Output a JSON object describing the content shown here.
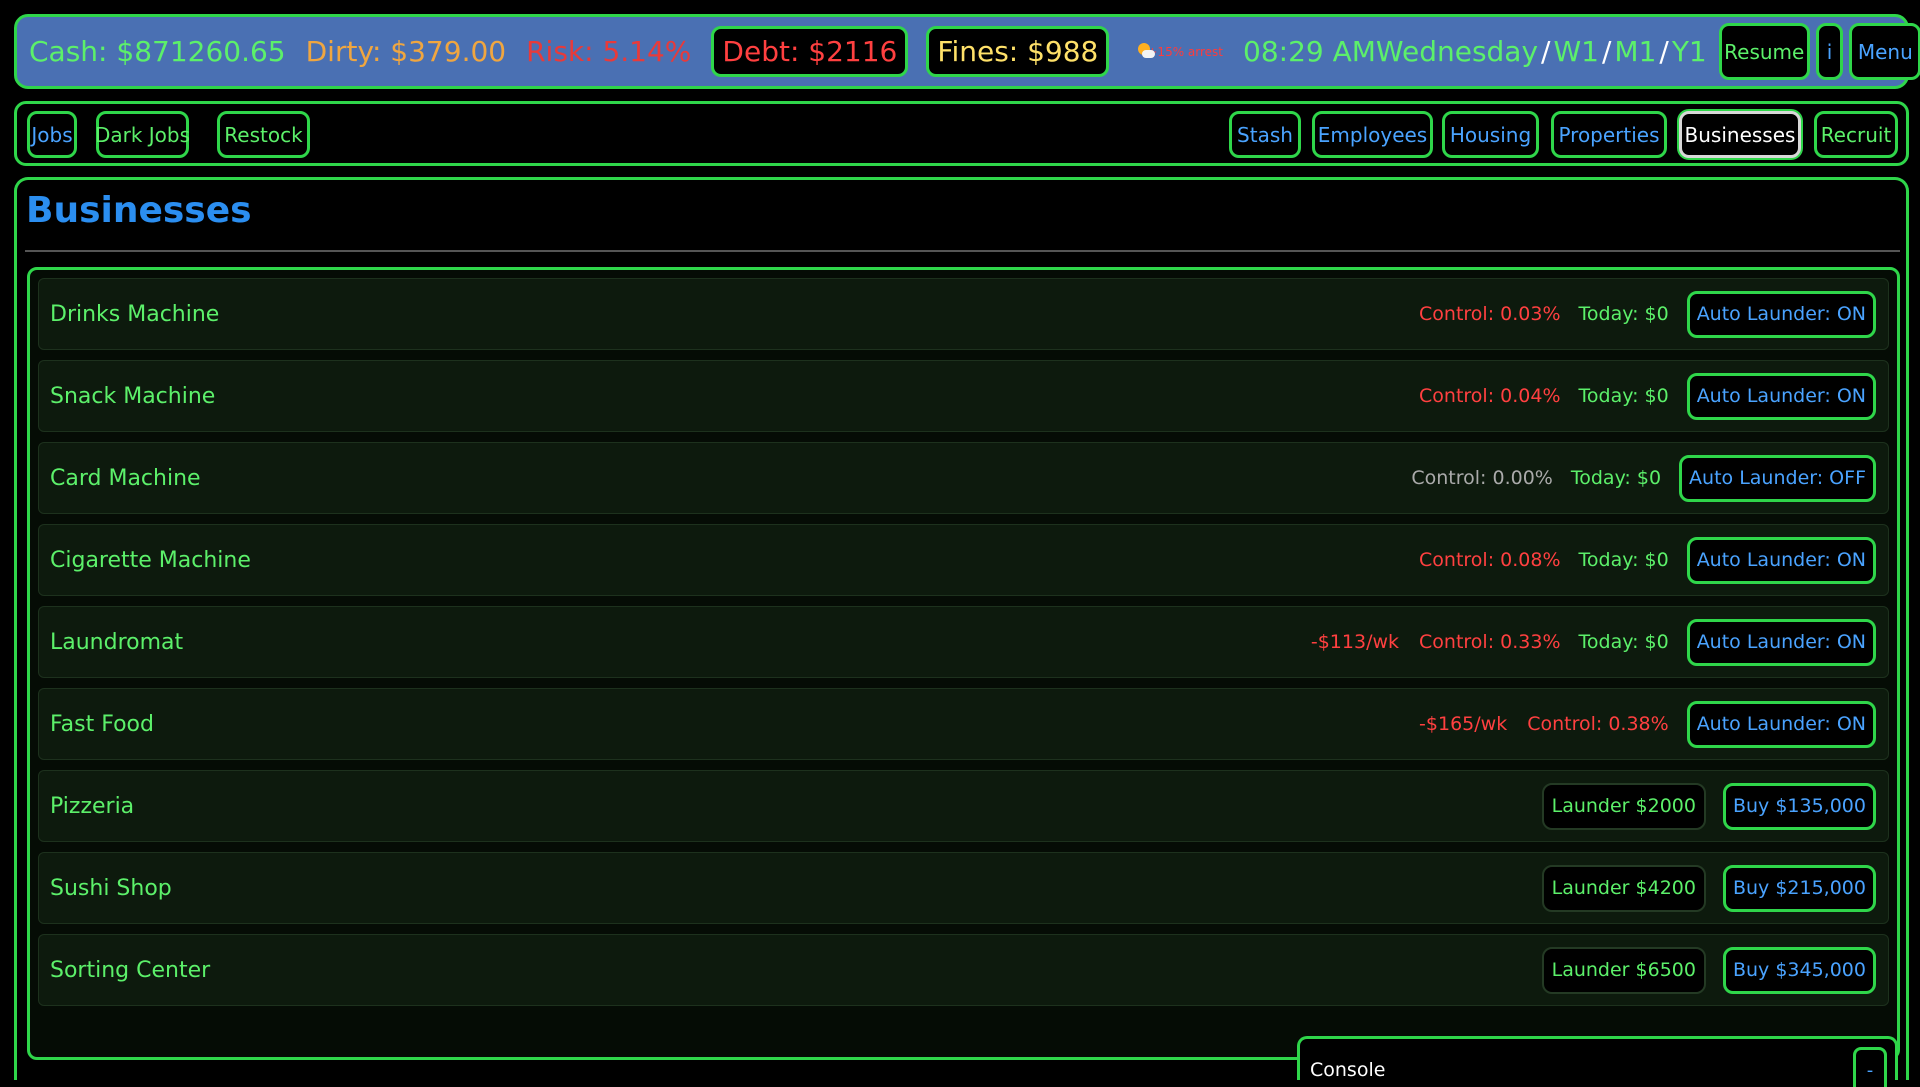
{
  "status": {
    "cash": "Cash: $871260.65",
    "dirty": "Dirty: $379.00",
    "risk": "Risk: 5.14%",
    "debt": "Debt: $2116",
    "fines": "Fines: $988",
    "weather_icon": "sun-cloud-icon",
    "weather_note": "+15% arrest",
    "time": "08:29 AM",
    "date_day": "Wednesday",
    "date_week": "W1",
    "date_month": "M1",
    "date_year": "Y1",
    "date_separator": "/",
    "resume_label": "Resume",
    "info_label": "i",
    "menu_label": "Menu"
  },
  "nav": {
    "jobs": "Jobs",
    "dark_jobs": "Dark Jobs",
    "restock": "Restock",
    "stash": "Stash",
    "employees": "Employees",
    "housing": "Housing",
    "properties": "Properties",
    "businesses": "Businesses",
    "recruit": "Recruit",
    "active_tab": "Businesses"
  },
  "page": {
    "title": "Businesses"
  },
  "businesses": [
    {
      "name": "Drinks Machine",
      "upkeep": "",
      "control": "Control: 0.03%",
      "today": "Today: $0",
      "action": "Auto Launder: ON"
    },
    {
      "name": "Snack Machine",
      "upkeep": "",
      "control": "Control: 0.04%",
      "today": "Today: $0",
      "action": "Auto Launder: ON"
    },
    {
      "name": "Card Machine",
      "upkeep": "",
      "control": "Control: 0.00%",
      "today": "Today: $0",
      "action": "Auto Launder: OFF"
    },
    {
      "name": "Cigarette Machine",
      "upkeep": "",
      "control": "Control: 0.08%",
      "today": "Today: $0",
      "action": "Auto Launder: ON"
    },
    {
      "name": "Laundromat",
      "upkeep": "-$113/wk",
      "control": "Control: 0.33%",
      "today": "Today: $0",
      "action": "Auto Launder: ON"
    },
    {
      "name": "Fast Food",
      "upkeep": "-$165/wk",
      "control": "Control: 0.38%",
      "today": "",
      "action": "Auto Launder: ON"
    },
    {
      "name": "Pizzeria",
      "launder": "Launder $2000",
      "buy": "Buy $135,000"
    },
    {
      "name": "Sushi Shop",
      "launder": "Launder $4200",
      "buy": "Buy $215,000"
    },
    {
      "name": "Sorting Center",
      "launder": "Launder $6500",
      "buy": "Buy $345,000"
    }
  ],
  "console": {
    "title": "Console",
    "toggle_label": "-"
  },
  "colors": {
    "border_green": "#2fd64a",
    "text_green": "#5cf06a",
    "link_blue": "#4aa3ff",
    "title_blue": "#2b8ef0",
    "danger_red": "#ff4040",
    "dirty_orange": "#f0a640",
    "fines_yellow": "#ffe169",
    "statusbar_blue": "#4a70b3"
  }
}
